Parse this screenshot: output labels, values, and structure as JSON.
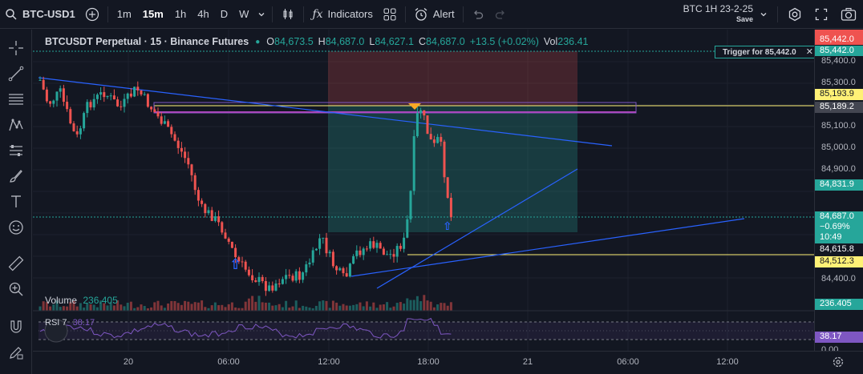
{
  "toolbar": {
    "symbol": "BTC-USD1",
    "timeframes": [
      "1m",
      "15m",
      "1h",
      "4h",
      "D",
      "W"
    ],
    "active_timeframe": "15m",
    "indicators_label": "Indicators",
    "alert_label": "Alert",
    "symbol_info": "BTC 1H 23-2-25",
    "save_label": "Save"
  },
  "legend": {
    "title": "BTCUSDT Perpetual · 15 · Binance Futures",
    "open_label": "O",
    "open": "84,673.5",
    "high_label": "H",
    "high": "84,687.0",
    "low_label": "L",
    "low": "84,627.1",
    "close_label": "C",
    "close": "84,687.0",
    "change": "+13.5 (+0.02%)",
    "vol_label": "Vol",
    "vol": "236.41"
  },
  "volume_legend": {
    "label": "Volume",
    "value": "236.405"
  },
  "rsi_legend": {
    "label": "RSI 7",
    "value": "38.17"
  },
  "trigger": {
    "text": "Trigger for 85,442.0"
  },
  "price_axis": {
    "ticks": [
      "85,400.0",
      "85,300.0",
      "85,100.0",
      "85,000.0",
      "84,900.0",
      "84,400.0",
      "0.00"
    ],
    "labels": {
      "top_red": "85,442.0",
      "top_green": "85,442.0",
      "yellow_1": "85,193.9",
      "purple": "85,189.2",
      "green_mid": "84,831.9",
      "current_price": "84,687.0",
      "current_change": "−0.69%",
      "countdown": "10:49",
      "support": "84,615.8",
      "yellow_2": "84,512.3",
      "volume": "236.405",
      "rsi": "38.17"
    }
  },
  "time_axis": {
    "ticks": [
      "20",
      "06:00",
      "12:00",
      "18:00",
      "21",
      "06:00",
      "12:00"
    ]
  },
  "colors": {
    "background": "#131722",
    "up": "#26a69a",
    "down": "#ef5350",
    "trendline": "#2962ff",
    "yellow": "#fff176",
    "purple": "#9c27b0"
  }
}
